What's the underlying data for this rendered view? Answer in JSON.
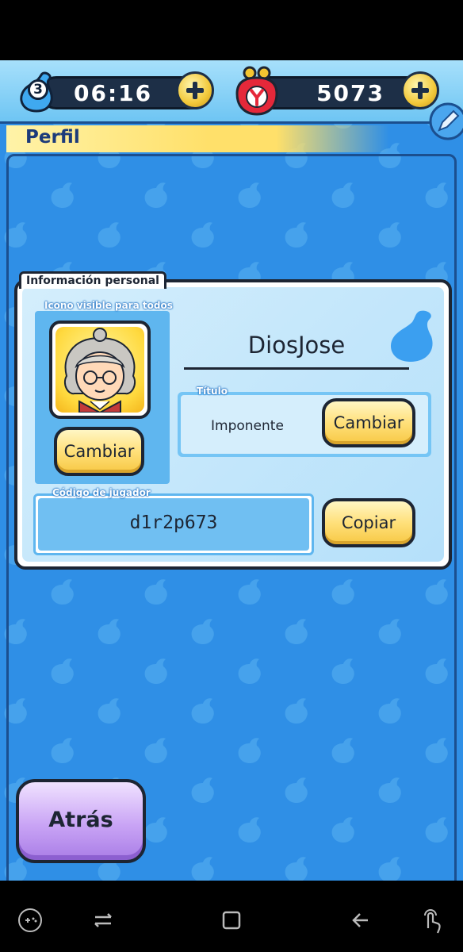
{
  "topbar": {
    "stamina_count": "3",
    "timer": "06:16",
    "coins": "5073"
  },
  "header": {
    "title": "Perfil"
  },
  "profile": {
    "section_label": "Información personal",
    "icon_label": "Icono visible para todos",
    "change_icon_button": "Cambiar",
    "player_name": "DiosJose",
    "title_label": "Título",
    "title_value": "Imponente",
    "change_title_button": "Cambiar",
    "code_label": "Código de jugador",
    "player_code": "d1r2p673",
    "copy_button": "Copiar"
  },
  "footer": {
    "back_button": "Atrás"
  },
  "icons": {
    "stamina": "stamina-drop-icon",
    "plus": "plus-icon",
    "coin": "coin-purse-icon",
    "edit": "pencil-icon",
    "avatar": "grandma-avatar-icon",
    "nav_game": "gamepad-icon",
    "nav_recents": "recents-icon",
    "nav_home": "home-icon",
    "nav_back": "back-arrow-icon",
    "nav_gesture": "touch-gesture-icon"
  },
  "colors": {
    "background": "#2f8fe6",
    "topbar": "#a7e0fb",
    "header_strip": "#ffe06a",
    "button_yellow": "#ffe07a",
    "button_purple": "#c9a4f5",
    "dark": "#1d2533"
  }
}
